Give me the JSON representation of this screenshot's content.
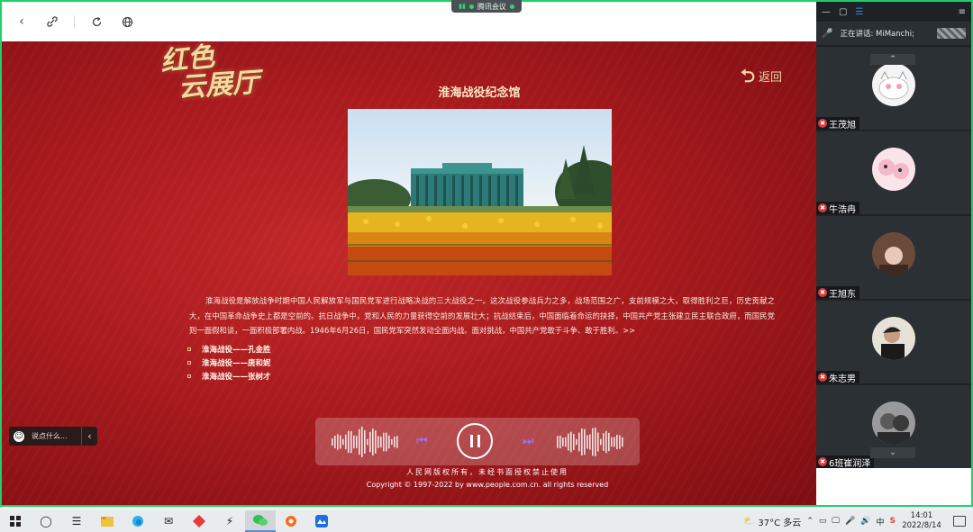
{
  "meeting": {
    "app_name": "腾讯会议",
    "speaking_label": "正在讲话: MiManchi;",
    "participants": [
      {
        "name": "王茂旭"
      },
      {
        "name": "牛浩冉"
      },
      {
        "name": "王旭东"
      },
      {
        "name": "朱志男"
      },
      {
        "name": "6班崔润泽"
      }
    ]
  },
  "page": {
    "logo_line1": "红色",
    "logo_line2": "云展厅",
    "back_label": "返回",
    "title": "淮海战役纪念馆",
    "description": "淮海战役是解放战争时期中国人民解放军与国民党军进行战略决战的三大战役之一。这次战役参战兵力之多，战场范围之广，支前规模之大，取得胜利之巨，历史贡献之大，在中国革命战争史上都是空前的。抗日战争中，党和人民的力量获得空前的发展壮大；抗战结束后，中国面临着命运的抉择，中国共产党主张建立民主联合政府，而国民党则一面假和谈，一面积极部署内战。1946年6月26日，国民党军突然发动全面内战。面对挑战，中国共产党敢于斗争、敢于胜利。>>",
    "links": [
      "淮海战役——孔金胜",
      "淮海战役——唐和妮",
      "淮海战役——张树才"
    ],
    "comment_placeholder": "说点什么...",
    "footer_rights": "人民网版权所有，未经书面授权禁止使用",
    "footer_copyright": "Copyright © 1997-2022 by www.people.com.cn. all rights reserved"
  },
  "taskbar": {
    "weather": "37°C 多云",
    "ime": "中",
    "time": "14:01",
    "date": "2022/8/14"
  }
}
